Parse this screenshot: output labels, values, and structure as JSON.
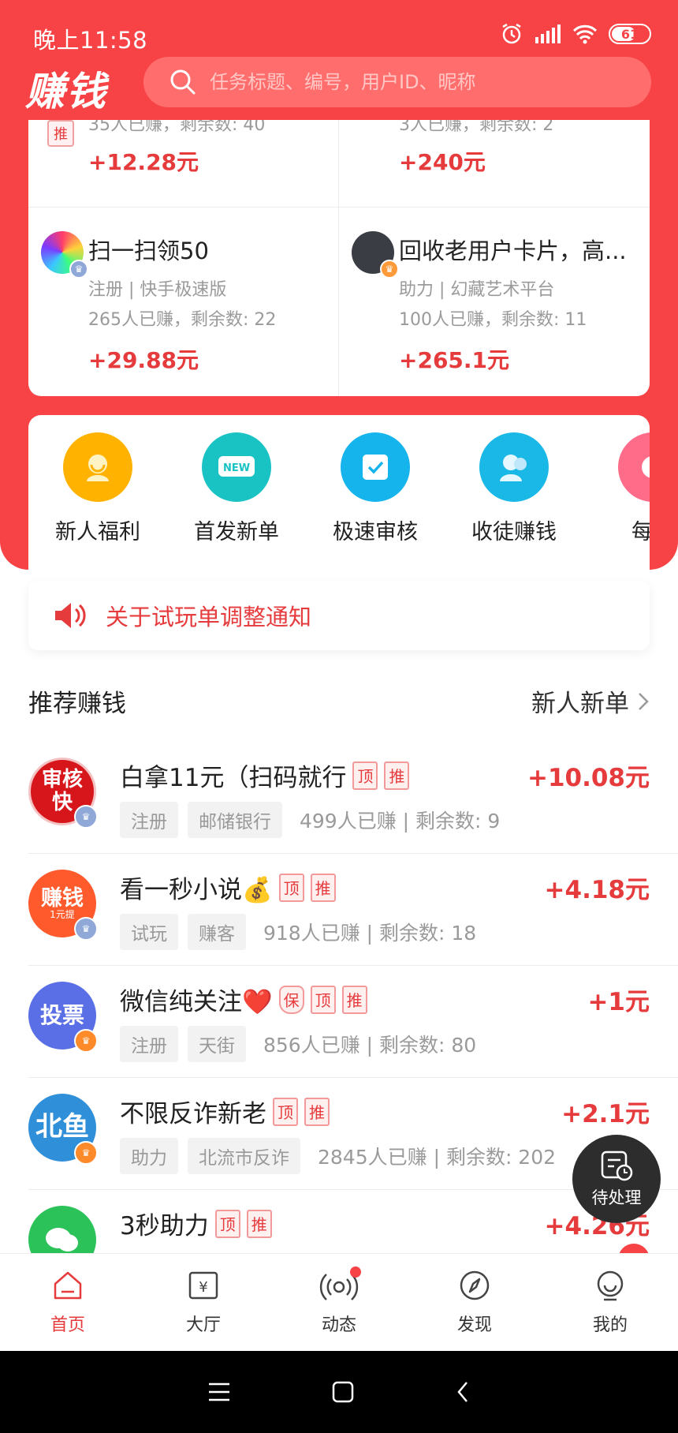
{
  "status_bar": {
    "time": "晚上11:58",
    "battery": "61"
  },
  "header": {
    "logo": "赚钱",
    "search_placeholder": "任务标题、编号，用户ID、昵称"
  },
  "task_grid": [
    {
      "meta_line2": "35人已赚，剩余数: 40",
      "reward": "+12.28元",
      "badge": "推"
    },
    {
      "meta_line2": "3人已赚，剩余数: 2",
      "reward": "+240元"
    },
    {
      "title": "扫一扫领50",
      "meta_line1": "注册 | 快手极速版",
      "meta_line2": "265人已赚，剩余数: 22",
      "reward": "+29.88元"
    },
    {
      "title": "回收老用户卡片，高...",
      "meta_line1": "助力 | 幻藏艺术平台",
      "meta_line2": "100人已赚，剩余数: 11",
      "reward": "+265.1元"
    }
  ],
  "quick_entries": [
    {
      "label": "新人福利",
      "icon": "smile-face-icon",
      "color": "#ffb300"
    },
    {
      "label": "首发新单",
      "icon": "new-badge-icon",
      "color": "#19c3c3"
    },
    {
      "label": "极速审核",
      "icon": "check-doc-icon",
      "color": "#15b4ec"
    },
    {
      "label": "收徒赚钱",
      "icon": "people-icon",
      "color": "#19b8e6"
    },
    {
      "label": "每日",
      "icon": "daily-icon",
      "color": "#ff6c8a"
    }
  ],
  "notice": {
    "text": "关于试玩单调整通知"
  },
  "recommend": {
    "title": "推荐赚钱",
    "more": "新人新单",
    "items": [
      {
        "title": "白拿11元（扫码就行",
        "tags": [
          "顶",
          "推"
        ],
        "chips": [
          "注册",
          "邮储银行"
        ],
        "stats": "499人已赚 | 剩余数: 9",
        "reward": "+10.08元",
        "avatar_text": "审核\n快",
        "avatar_color": "#d6161b"
      },
      {
        "title": "看一秒小说💰",
        "tags": [
          "顶",
          "推"
        ],
        "chips": [
          "试玩",
          "赚客"
        ],
        "stats": "918人已赚 | 剩余数: 18",
        "reward": "+4.18元",
        "avatar_text": "赚钱",
        "avatar_sub": "1元提",
        "avatar_color": "#ff5a2c"
      },
      {
        "title": "微信纯关注❤️",
        "tags": [
          "保",
          "顶",
          "推"
        ],
        "chips": [
          "注册",
          "天街"
        ],
        "stats": "856人已赚 | 剩余数: 80",
        "reward": "+1元",
        "avatar_text": "投票",
        "avatar_color": "#5a6fe6"
      },
      {
        "title": "不限反诈新老",
        "tags": [
          "顶",
          "推"
        ],
        "chips": [
          "助力",
          "北流市反诈"
        ],
        "stats": "2845人已赚 | 剩余数: 202",
        "reward": "+2.1元",
        "avatar_text": "北鱼",
        "avatar_color": "#2f8fd8"
      },
      {
        "title": "3秒助力",
        "tags": [
          "顶",
          "推"
        ],
        "chips": [],
        "stats": "",
        "reward": "+4.26元",
        "avatar_text": "",
        "avatar_color": "#2cc25a"
      }
    ]
  },
  "pending_button": {
    "label": "待处理"
  },
  "bottom_nav": [
    {
      "label": "首页",
      "icon": "home-icon",
      "active": true
    },
    {
      "label": "大厅",
      "icon": "hall-icon"
    },
    {
      "label": "动态",
      "icon": "broadcast-icon"
    },
    {
      "label": "发现",
      "icon": "compass-icon"
    },
    {
      "label": "我的",
      "icon": "profile-icon"
    }
  ],
  "colors": {
    "brand_red": "#f74345",
    "reward_red": "#e63b3d"
  }
}
